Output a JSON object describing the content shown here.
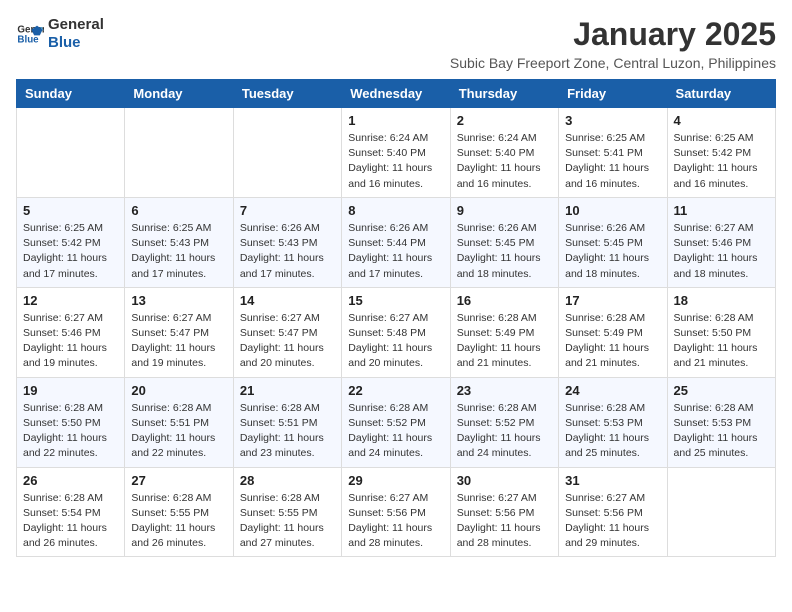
{
  "logo": {
    "line1": "General",
    "line2": "Blue"
  },
  "title": "January 2025",
  "subtitle": "Subic Bay Freeport Zone, Central Luzon, Philippines",
  "weekdays": [
    "Sunday",
    "Monday",
    "Tuesday",
    "Wednesday",
    "Thursday",
    "Friday",
    "Saturday"
  ],
  "weeks": [
    [
      {
        "day": "",
        "info": ""
      },
      {
        "day": "",
        "info": ""
      },
      {
        "day": "",
        "info": ""
      },
      {
        "day": "1",
        "info": "Sunrise: 6:24 AM\nSunset: 5:40 PM\nDaylight: 11 hours and 16 minutes."
      },
      {
        "day": "2",
        "info": "Sunrise: 6:24 AM\nSunset: 5:40 PM\nDaylight: 11 hours and 16 minutes."
      },
      {
        "day": "3",
        "info": "Sunrise: 6:25 AM\nSunset: 5:41 PM\nDaylight: 11 hours and 16 minutes."
      },
      {
        "day": "4",
        "info": "Sunrise: 6:25 AM\nSunset: 5:42 PM\nDaylight: 11 hours and 16 minutes."
      }
    ],
    [
      {
        "day": "5",
        "info": "Sunrise: 6:25 AM\nSunset: 5:42 PM\nDaylight: 11 hours and 17 minutes."
      },
      {
        "day": "6",
        "info": "Sunrise: 6:25 AM\nSunset: 5:43 PM\nDaylight: 11 hours and 17 minutes."
      },
      {
        "day": "7",
        "info": "Sunrise: 6:26 AM\nSunset: 5:43 PM\nDaylight: 11 hours and 17 minutes."
      },
      {
        "day": "8",
        "info": "Sunrise: 6:26 AM\nSunset: 5:44 PM\nDaylight: 11 hours and 17 minutes."
      },
      {
        "day": "9",
        "info": "Sunrise: 6:26 AM\nSunset: 5:45 PM\nDaylight: 11 hours and 18 minutes."
      },
      {
        "day": "10",
        "info": "Sunrise: 6:26 AM\nSunset: 5:45 PM\nDaylight: 11 hours and 18 minutes."
      },
      {
        "day": "11",
        "info": "Sunrise: 6:27 AM\nSunset: 5:46 PM\nDaylight: 11 hours and 18 minutes."
      }
    ],
    [
      {
        "day": "12",
        "info": "Sunrise: 6:27 AM\nSunset: 5:46 PM\nDaylight: 11 hours and 19 minutes."
      },
      {
        "day": "13",
        "info": "Sunrise: 6:27 AM\nSunset: 5:47 PM\nDaylight: 11 hours and 19 minutes."
      },
      {
        "day": "14",
        "info": "Sunrise: 6:27 AM\nSunset: 5:47 PM\nDaylight: 11 hours and 20 minutes."
      },
      {
        "day": "15",
        "info": "Sunrise: 6:27 AM\nSunset: 5:48 PM\nDaylight: 11 hours and 20 minutes."
      },
      {
        "day": "16",
        "info": "Sunrise: 6:28 AM\nSunset: 5:49 PM\nDaylight: 11 hours and 21 minutes."
      },
      {
        "day": "17",
        "info": "Sunrise: 6:28 AM\nSunset: 5:49 PM\nDaylight: 11 hours and 21 minutes."
      },
      {
        "day": "18",
        "info": "Sunrise: 6:28 AM\nSunset: 5:50 PM\nDaylight: 11 hours and 21 minutes."
      }
    ],
    [
      {
        "day": "19",
        "info": "Sunrise: 6:28 AM\nSunset: 5:50 PM\nDaylight: 11 hours and 22 minutes."
      },
      {
        "day": "20",
        "info": "Sunrise: 6:28 AM\nSunset: 5:51 PM\nDaylight: 11 hours and 22 minutes."
      },
      {
        "day": "21",
        "info": "Sunrise: 6:28 AM\nSunset: 5:51 PM\nDaylight: 11 hours and 23 minutes."
      },
      {
        "day": "22",
        "info": "Sunrise: 6:28 AM\nSunset: 5:52 PM\nDaylight: 11 hours and 24 minutes."
      },
      {
        "day": "23",
        "info": "Sunrise: 6:28 AM\nSunset: 5:52 PM\nDaylight: 11 hours and 24 minutes."
      },
      {
        "day": "24",
        "info": "Sunrise: 6:28 AM\nSunset: 5:53 PM\nDaylight: 11 hours and 25 minutes."
      },
      {
        "day": "25",
        "info": "Sunrise: 6:28 AM\nSunset: 5:53 PM\nDaylight: 11 hours and 25 minutes."
      }
    ],
    [
      {
        "day": "26",
        "info": "Sunrise: 6:28 AM\nSunset: 5:54 PM\nDaylight: 11 hours and 26 minutes."
      },
      {
        "day": "27",
        "info": "Sunrise: 6:28 AM\nSunset: 5:55 PM\nDaylight: 11 hours and 26 minutes."
      },
      {
        "day": "28",
        "info": "Sunrise: 6:28 AM\nSunset: 5:55 PM\nDaylight: 11 hours and 27 minutes."
      },
      {
        "day": "29",
        "info": "Sunrise: 6:27 AM\nSunset: 5:56 PM\nDaylight: 11 hours and 28 minutes."
      },
      {
        "day": "30",
        "info": "Sunrise: 6:27 AM\nSunset: 5:56 PM\nDaylight: 11 hours and 28 minutes."
      },
      {
        "day": "31",
        "info": "Sunrise: 6:27 AM\nSunset: 5:56 PM\nDaylight: 11 hours and 29 minutes."
      },
      {
        "day": "",
        "info": ""
      }
    ]
  ]
}
